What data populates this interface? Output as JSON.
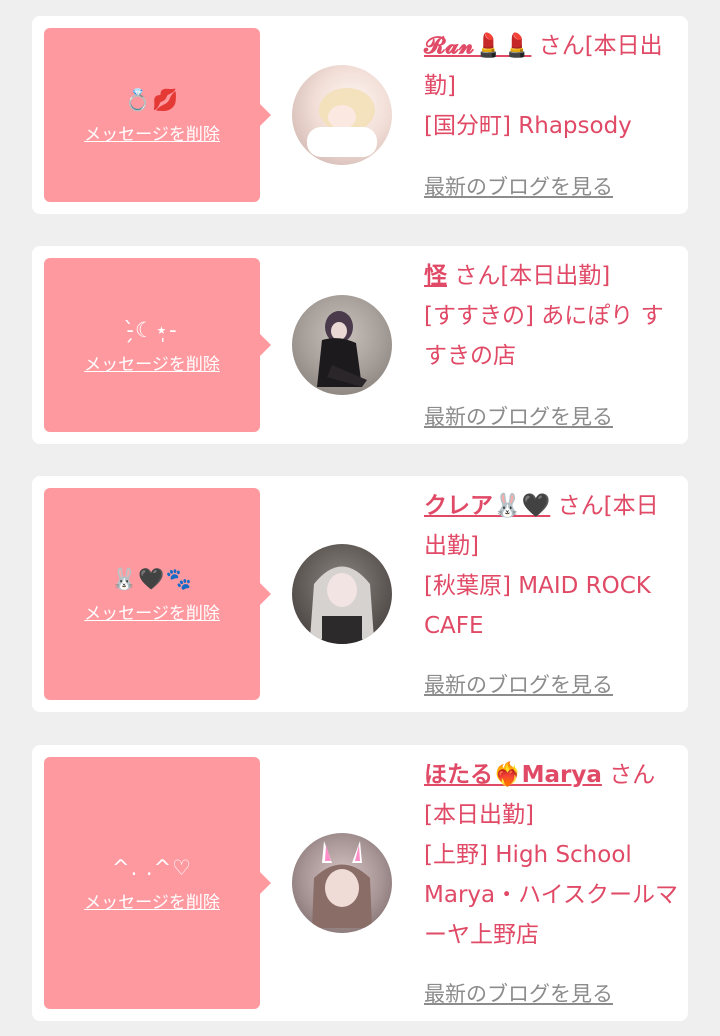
{
  "delete_label": "メッセージを削除",
  "blog_label": "最新のブログを見る",
  "san_suffix": "さん",
  "colors": {
    "bubble": "#ff99a0",
    "text": "#e04a66",
    "link_gray": "#8c8c8c"
  },
  "messages": [
    {
      "stamp": "💍💋",
      "name": "𝓡𝓪𝓷💄💄",
      "status": "[本日出勤]",
      "area": "[国分町]",
      "shop": "Rhapsody"
    },
    {
      "stamp": "-̗̀☾⋆̩-",
      "name": "怪",
      "status": "[本日出勤]",
      "area": "[すすきの]",
      "shop": "あにぽり すすきの店"
    },
    {
      "stamp": "🐰🖤🐾",
      "name": "クレア🐰🖤",
      "status": "[本日出勤]",
      "area": "[秋葉原]",
      "shop": "MAID ROCK CAFE"
    },
    {
      "stamp": "^. .^♡",
      "name": "ほたる❤️‍🔥Marya",
      "status": "[本日出勤]",
      "area": "[上野]",
      "shop": "High School Marya・ハイスクールマーヤ上野店"
    }
  ]
}
